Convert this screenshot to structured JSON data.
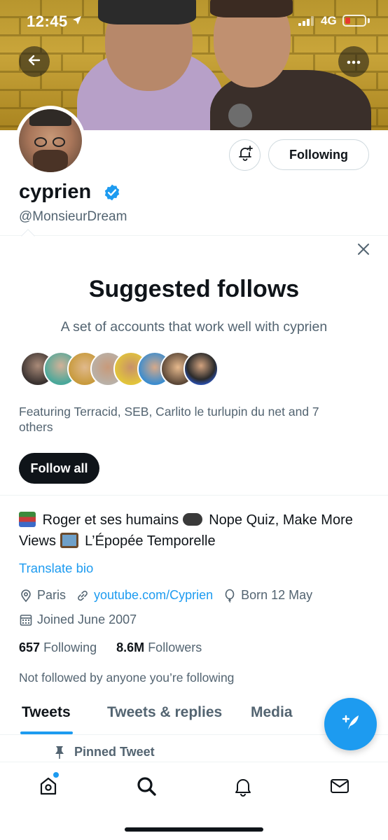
{
  "status_bar": {
    "time": "12:45",
    "network": "4G"
  },
  "profile": {
    "name": "cyprien",
    "handle": "@MonsieurDream",
    "following_button": "Following",
    "bio_parts": [
      "Roger et ses humains",
      "Nope Quiz, Make More Views",
      "L’Épopée Temporelle"
    ],
    "translate_bio": "Translate bio",
    "location": "Paris",
    "website": "youtube.com/Cyprien",
    "born": "Born 12 May",
    "joined": "Joined June 2007",
    "following_count": "657",
    "following_label": "Following",
    "followers_count": "8.6M",
    "followers_label": "Followers",
    "followed_by": "Not followed by anyone you’re following"
  },
  "suggested": {
    "title": "Suggested follows",
    "subtitle": "A set of accounts that work well with cyprien",
    "featuring": "Featuring Terracid, SEB, Carlito le turlupin du net and 7 others",
    "follow_all": "Follow all"
  },
  "tabs": [
    {
      "label": "Tweets",
      "active": true
    },
    {
      "label": "Tweets & replies",
      "active": false
    },
    {
      "label": "Media",
      "active": false
    }
  ],
  "pinned_label": "Pinned Tweet",
  "colors": {
    "accent": "#1d9bf0",
    "text": "#0f1419",
    "secondary": "#536471"
  },
  "icons": [
    "back-arrow-icon",
    "more-icon",
    "bell-plus-icon",
    "verified-icon",
    "close-icon",
    "location-icon",
    "link-icon",
    "balloon-icon",
    "calendar-icon",
    "compose-icon",
    "pin-icon",
    "home-icon",
    "search-icon",
    "notifications-icon",
    "messages-icon"
  ]
}
